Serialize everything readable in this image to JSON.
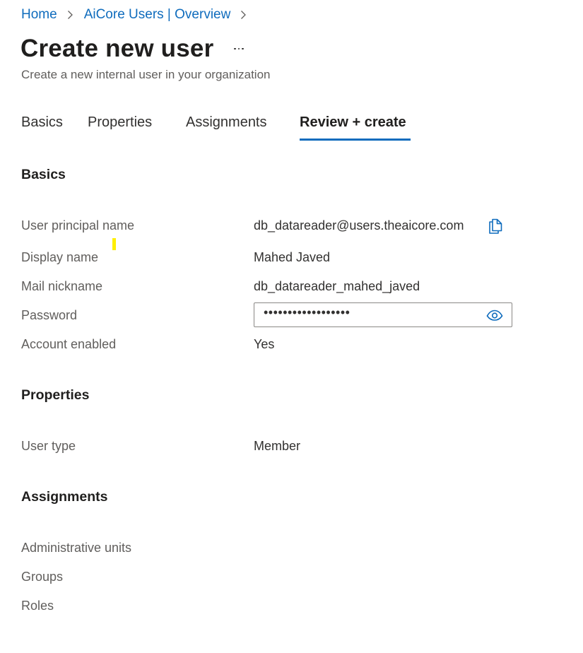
{
  "breadcrumb": {
    "items": [
      "Home",
      "AiCore Users | Overview"
    ]
  },
  "header": {
    "title": "Create new user",
    "more_label": "...",
    "subtitle": "Create a new internal user in your organization"
  },
  "tabs": [
    {
      "label": "Basics",
      "active": false
    },
    {
      "label": "Properties",
      "active": false
    },
    {
      "label": "Assignments",
      "active": false
    },
    {
      "label": "Review + create",
      "active": true
    }
  ],
  "sections": {
    "basics": {
      "title": "Basics",
      "fields": [
        {
          "label": "User principal name",
          "value": "db_datareader@users.theaicore.com",
          "icon": "copy-icon"
        },
        {
          "label": "Display name",
          "value": "Mahed Javed"
        },
        {
          "label": "Mail nickname",
          "value": "db_datareader_mahed_javed"
        },
        {
          "label": "Password",
          "value": "••••••••••••••••••",
          "icon": "eye-icon"
        },
        {
          "label": "Account enabled",
          "value": "Yes"
        }
      ]
    },
    "properties": {
      "title": "Properties",
      "fields": [
        {
          "label": "User type",
          "value": "Member"
        }
      ]
    },
    "assignments": {
      "title": "Assignments",
      "fields": [
        {
          "label": "Administrative units",
          "value": ""
        },
        {
          "label": "Groups",
          "value": ""
        },
        {
          "label": "Roles",
          "value": ""
        }
      ]
    }
  },
  "colors": {
    "accent": "#0f6cbd",
    "text": "#323130",
    "label": "#605e5c",
    "highlight": "#ffef00"
  }
}
